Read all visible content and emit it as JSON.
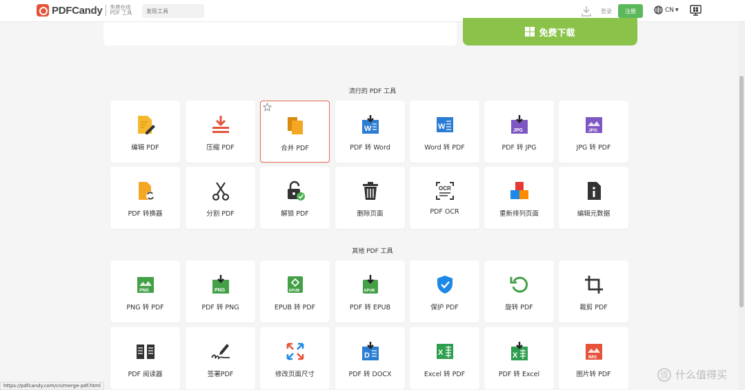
{
  "header": {
    "logo_text": "PDFCandy",
    "logo_tagline": "免费在线 PDF 工具",
    "search_placeholder": "发现工具",
    "login_label": "登录",
    "register_label": "注册",
    "language": "CN"
  },
  "hero": {
    "free_download_label": "免费下载"
  },
  "popular": {
    "title": "流行的 PDF 工具",
    "tools": [
      {
        "label": "编辑 PDF",
        "icon": "edit-pdf-icon"
      },
      {
        "label": "压缩 PDF",
        "icon": "compress-pdf-icon"
      },
      {
        "label": "合并 PDF",
        "icon": "merge-pdf-icon"
      },
      {
        "label": "PDF 转 Word",
        "icon": "pdf-to-word-icon"
      },
      {
        "label": "Word 转 PDF",
        "icon": "word-to-pdf-icon"
      },
      {
        "label": "PDF 转 JPG",
        "icon": "pdf-to-jpg-icon"
      },
      {
        "label": "JPG 转 PDF",
        "icon": "jpg-to-pdf-icon"
      },
      {
        "label": "PDF 转换器",
        "icon": "pdf-converter-icon"
      },
      {
        "label": "分割 PDF",
        "icon": "split-pdf-icon"
      },
      {
        "label": "解锁 PDF",
        "icon": "unlock-pdf-icon"
      },
      {
        "label": "删除页面",
        "icon": "delete-pages-icon"
      },
      {
        "label": "PDF OCR",
        "icon": "pdf-ocr-icon"
      },
      {
        "label": "重新排列页面",
        "icon": "rearrange-pages-icon"
      },
      {
        "label": "编辑元数据",
        "icon": "edit-metadata-icon"
      }
    ]
  },
  "other": {
    "title": "其他 PDF 工具",
    "tools": [
      {
        "label": "PNG 转 PDF",
        "icon": "png-to-pdf-icon"
      },
      {
        "label": "PDF 转 PNG",
        "icon": "pdf-to-png-icon"
      },
      {
        "label": "EPUB 转 PDF",
        "icon": "epub-to-pdf-icon"
      },
      {
        "label": "PDF 转 EPUB",
        "icon": "pdf-to-epub-icon"
      },
      {
        "label": "保护 PDF",
        "icon": "protect-pdf-icon"
      },
      {
        "label": "旋转 PDF",
        "icon": "rotate-pdf-icon"
      },
      {
        "label": "裁剪 PDF",
        "icon": "crop-pdf-icon"
      },
      {
        "label": "PDF 阅读器",
        "icon": "pdf-reader-icon"
      },
      {
        "label": "签署PDF",
        "icon": "sign-pdf-icon"
      },
      {
        "label": "修改页面尺寸",
        "icon": "resize-pages-icon"
      },
      {
        "label": "PDF 转 DOCX",
        "icon": "pdf-to-docx-icon"
      },
      {
        "label": "Excel 转 PDF",
        "icon": "excel-to-pdf-icon"
      },
      {
        "label": "PDF 转 Excel",
        "icon": "pdf-to-excel-icon"
      },
      {
        "label": "图片转 PDF",
        "icon": "image-to-pdf-icon"
      }
    ]
  },
  "status_url": "https://pdfcandy.com/cn/merge-pdf.html",
  "watermark": {
    "text": "什么值得买",
    "glyph": "值"
  },
  "colors": {
    "register_green": "#5cb85c",
    "download_green": "#8bc34a",
    "active_border": "#e06a50"
  }
}
